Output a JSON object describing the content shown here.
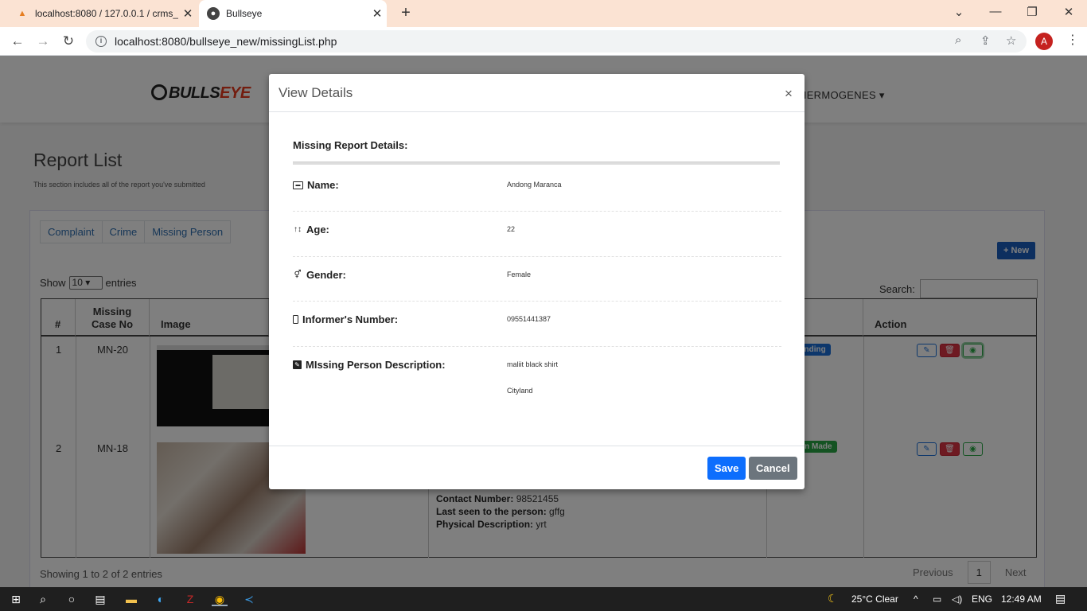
{
  "browser": {
    "tabs": [
      {
        "title": "localhost:8080 / 127.0.0.1 / crms_",
        "favicon": "phpmyadmin-icon",
        "active": false
      },
      {
        "title": "Bullseye",
        "favicon": "globe-icon",
        "active": true
      }
    ],
    "url": "localhost:8080/bullseye_new/missingList.php",
    "profile_initial": "A"
  },
  "nav": {
    "logo_text": "BULLS",
    "logo_accent": "EYE",
    "user_menu": "NG HERMOGENES"
  },
  "page": {
    "title": "Report List",
    "subtitle": "This section includes all of the report you've submitted",
    "tabs": [
      "Complaint",
      "Crime",
      "Missing Person"
    ],
    "new_button": "New",
    "show_label": "Show",
    "entries_value": "10",
    "entries_label": "entries",
    "search_label": "Search:",
    "columns": [
      "#",
      "Missing Case No",
      "Image",
      "s",
      "Action"
    ],
    "rows": [
      {
        "num": "1",
        "case": "MN-20",
        "status": "ending",
        "status_color": "#1a6fd8"
      },
      {
        "num": "2",
        "case": "MN-18",
        "status": "on Made",
        "status_color": "#28a745"
      }
    ],
    "row2_details": [
      {
        "label": "Contact Number:",
        "value": "98521455"
      },
      {
        "label": "Last seen to the person:",
        "value": "gffg"
      },
      {
        "label": "Physical Description:",
        "value": "yrt"
      }
    ],
    "footer_info": "Showing 1 to 2 of 2 entries",
    "pager": {
      "prev": "Previous",
      "current": "1",
      "next": "Next"
    }
  },
  "modal": {
    "title": "View Details",
    "close": "×",
    "section_title": "Missing Report Details:",
    "fields": [
      {
        "label": "Name:",
        "value": "Andong Maranca"
      },
      {
        "label": "Age:",
        "value": "22"
      },
      {
        "label": "Gender:",
        "value": "Female"
      },
      {
        "label": "Informer's Number:",
        "value": "09551441387"
      },
      {
        "label": "MIssing Person Description:",
        "value": "maliit black shirt",
        "value2": "Cityland"
      }
    ],
    "save_label": "Save",
    "cancel_label": "Cancel"
  },
  "taskbar": {
    "weather": "25°C  Clear",
    "lang": "ENG",
    "time": "12:49 AM"
  }
}
